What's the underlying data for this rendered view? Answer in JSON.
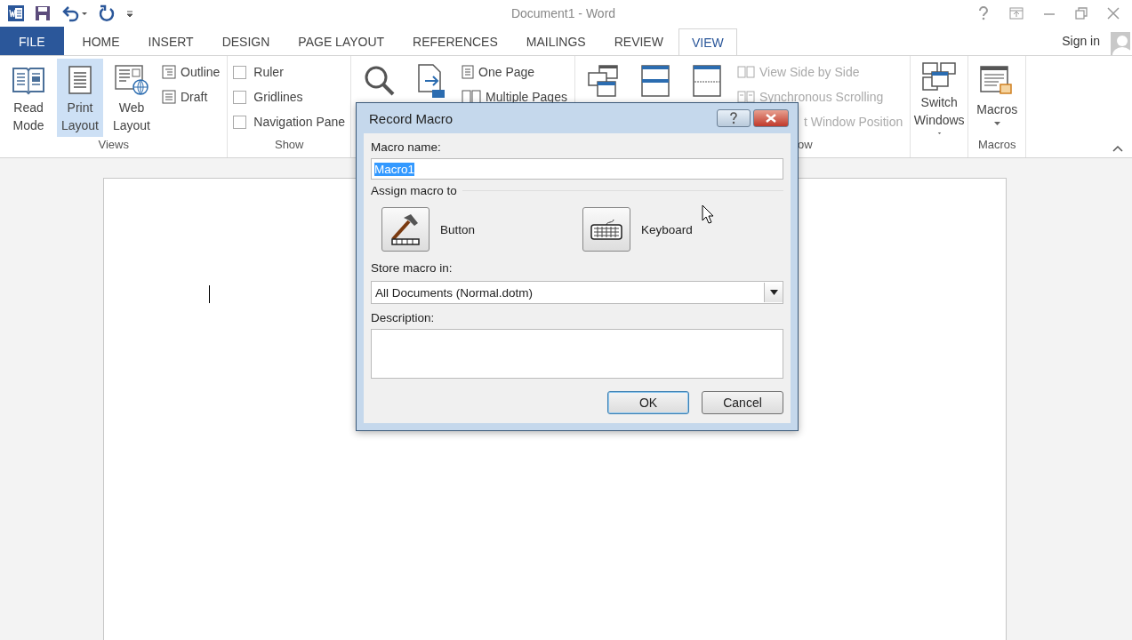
{
  "window": {
    "title": "Document1 - Word"
  },
  "tabs": [
    {
      "label": "FILE",
      "kind": "file",
      "selected": false
    },
    {
      "label": "HOME",
      "kind": "tab",
      "selected": false
    },
    {
      "label": "INSERT",
      "kind": "tab",
      "selected": false
    },
    {
      "label": "DESIGN",
      "kind": "tab",
      "selected": false
    },
    {
      "label": "PAGE LAYOUT",
      "kind": "tab",
      "selected": false
    },
    {
      "label": "REFERENCES",
      "kind": "tab",
      "selected": false
    },
    {
      "label": "MAILINGS",
      "kind": "tab",
      "selected": false
    },
    {
      "label": "REVIEW",
      "kind": "tab",
      "selected": false
    },
    {
      "label": "VIEW",
      "kind": "tab",
      "selected": true
    }
  ],
  "sign_in": "Sign in",
  "ribbon": {
    "groups": [
      {
        "label": "Views",
        "items": [
          {
            "kind": "large",
            "label": "Read Mode",
            "selected": false
          },
          {
            "kind": "large",
            "label": "Print Layout",
            "selected": true
          },
          {
            "kind": "large",
            "label": "Web Layout",
            "selected": false
          },
          {
            "kind": "small",
            "label": "Outline",
            "disabled": false
          },
          {
            "kind": "small",
            "label": "Draft",
            "disabled": false
          }
        ]
      },
      {
        "label": "Show",
        "items": [
          {
            "kind": "check",
            "label": "Ruler",
            "checked": false
          },
          {
            "kind": "check",
            "label": "Gridlines",
            "checked": false
          },
          {
            "kind": "check",
            "label": "Navigation Pane",
            "checked": false
          }
        ]
      },
      {
        "items": [
          {
            "kind": "large",
            "selected": false
          },
          {
            "kind": "large",
            "selected": false
          },
          {
            "kind": "small",
            "label": "One Page",
            "disabled": false
          },
          {
            "kind": "small",
            "label": "Multiple Pages",
            "disabled": false
          }
        ]
      },
      {
        "label": "ow",
        "items": [
          {
            "kind": "large",
            "selected": false
          },
          {
            "kind": "large",
            "selected": false
          },
          {
            "kind": "large",
            "selected": false
          },
          {
            "kind": "small",
            "label": "View Side by Side",
            "disabled": true
          },
          {
            "kind": "small",
            "label": "Synchronous Scrolling",
            "disabled": true
          },
          {
            "kind": "small",
            "label": "t Window Position",
            "disabled": true
          }
        ]
      },
      {
        "items": [
          {
            "kind": "large",
            "label": "Switch Windows",
            "menu": true,
            "selected": false
          }
        ]
      },
      {
        "label": "Macros",
        "items": [
          {
            "kind": "large",
            "label": "Macros",
            "menu": true,
            "selected": false
          }
        ]
      }
    ]
  },
  "dialog": {
    "title": "Record Macro",
    "macro_name": {
      "label": "Macro name:",
      "value": "Macro1",
      "value_selected": true
    },
    "assign": {
      "label": "Assign macro to",
      "options": [
        {
          "label": "Button"
        },
        {
          "label": "Keyboard"
        }
      ]
    },
    "store": {
      "label": "Store macro in:",
      "value": "All Documents (Normal.dotm)"
    },
    "description": {
      "label": "Description:"
    },
    "buttons": [
      {
        "label": "OK",
        "default": true
      },
      {
        "label": "Cancel",
        "default": false
      }
    ]
  }
}
